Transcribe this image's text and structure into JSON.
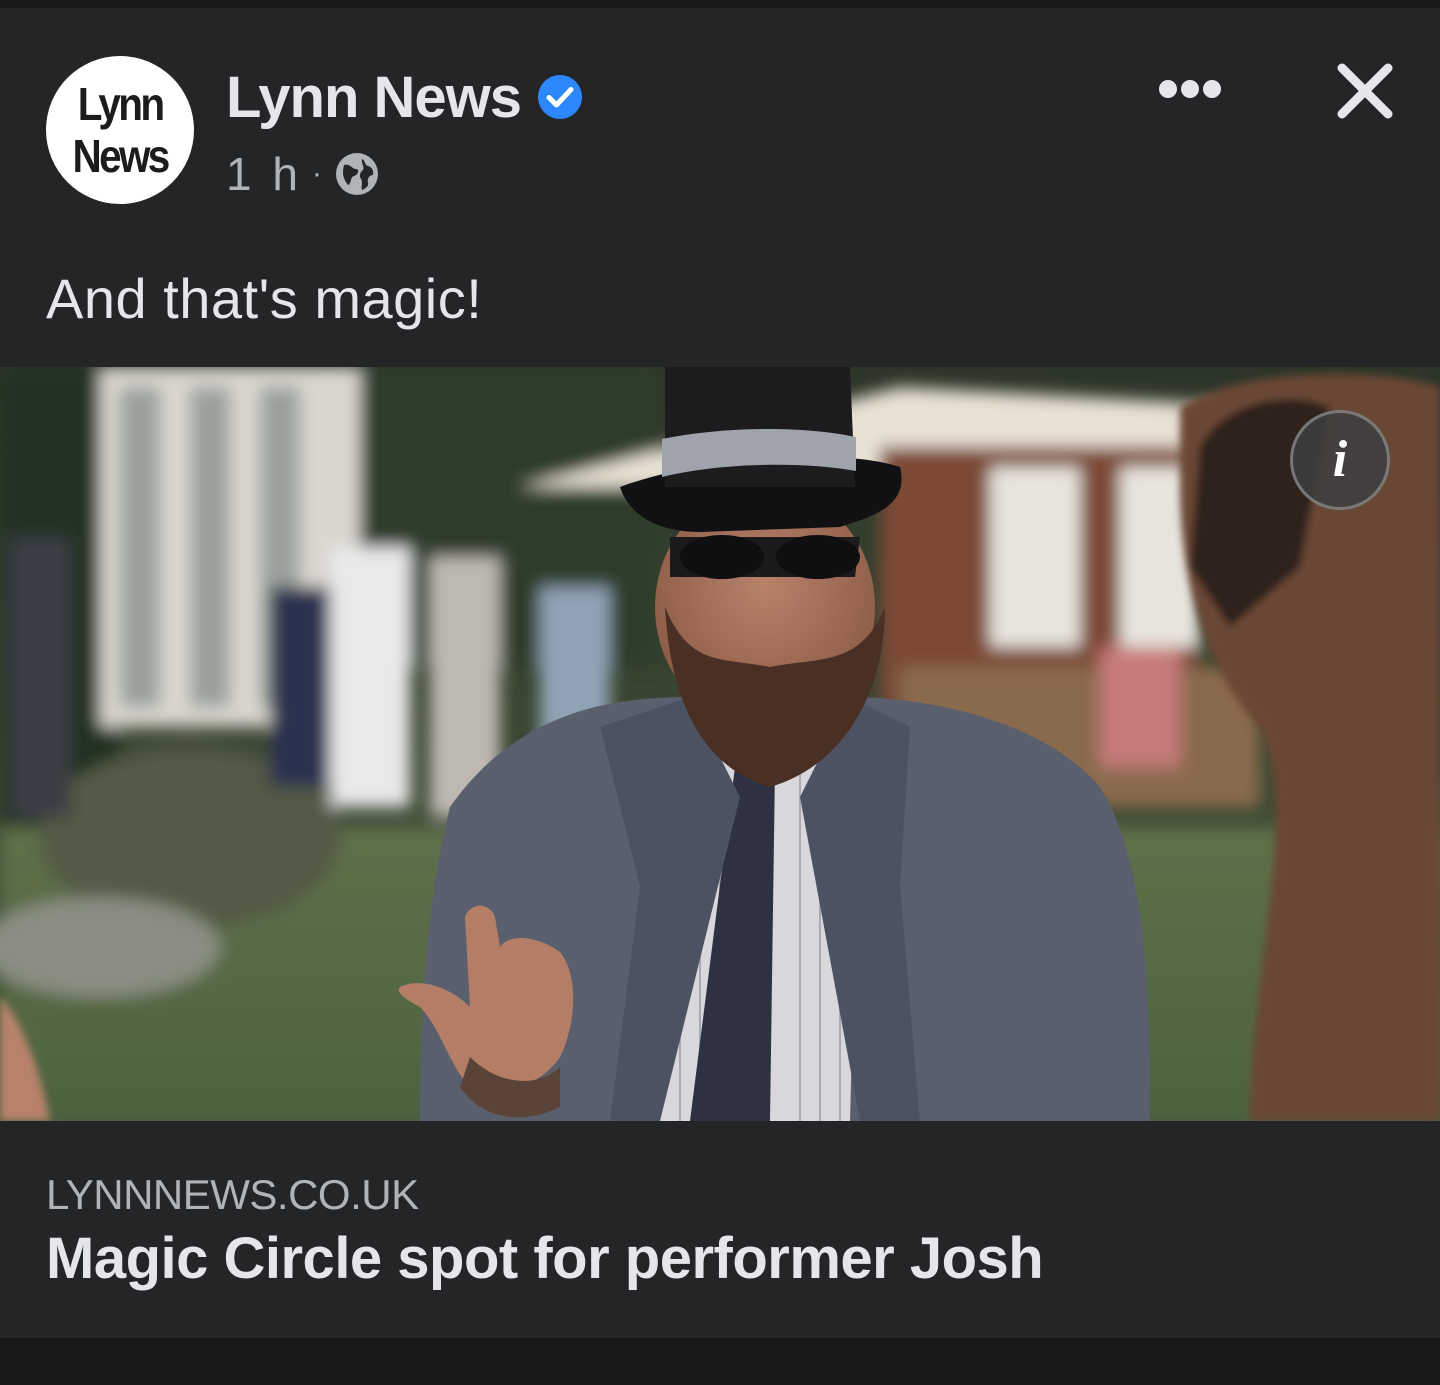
{
  "post": {
    "author": {
      "name": "Lynn News",
      "avatar_line1": "Lynn",
      "avatar_line2": "News",
      "verified": true
    },
    "time": "1 h",
    "separator": "·",
    "audience_icon": "globe-icon",
    "caption": "And that's magic!",
    "more_icon": "more-horizontal-icon",
    "close_icon": "close-icon",
    "photo": {
      "info_label": "i"
    },
    "link": {
      "domain": "LYNNNEWS.CO.UK",
      "headline": "Magic Circle spot for performer Josh"
    }
  },
  "colors": {
    "background": "#18191a",
    "card": "#242526",
    "primary_text": "#e4e6eb",
    "secondary_text": "#b0b3b8",
    "verified_blue": "#2d88ff"
  }
}
